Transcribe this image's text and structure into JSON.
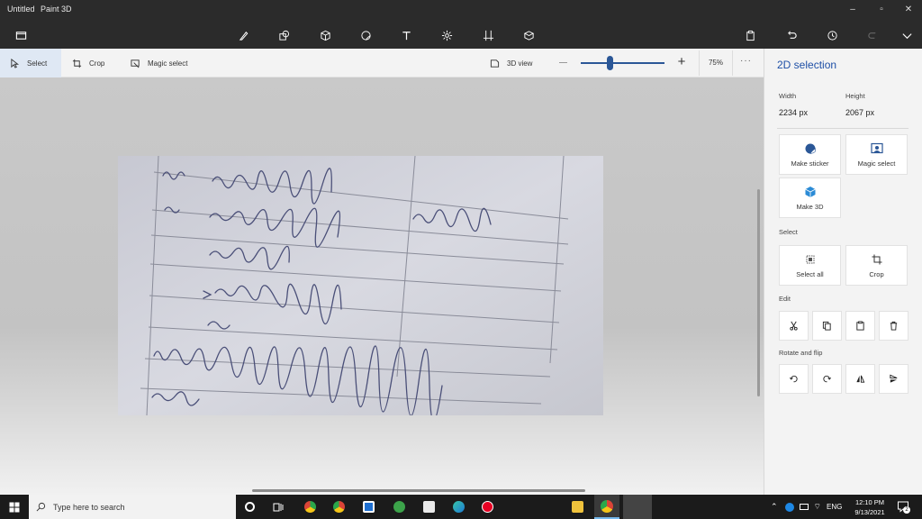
{
  "window": {
    "doc_name": "Untitled",
    "app_name": "Paint 3D"
  },
  "window_controls": {
    "minimize": "–",
    "restore": "▫",
    "close": "✕"
  },
  "main_tools": [
    "brushes-icon",
    "2d-shapes-icon",
    "3d-shapes-icon",
    "stickers-icon",
    "text-icon",
    "effects-icon",
    "canvas-icon",
    "3d-library-icon"
  ],
  "toolbar2": {
    "select": "Select",
    "crop": "Crop",
    "magic_select": "Magic select",
    "view_3d": "3D view",
    "zoom_plus": "+",
    "zoom_level": "75%",
    "zoom_fraction": 0.35,
    "more": "···"
  },
  "panel": {
    "title": "2D selection",
    "width_label": "Width",
    "width_value": "2234 px",
    "height_label": "Height",
    "height_value": "2067 px",
    "make_sticker": "Make sticker",
    "magic_select": "Magic select",
    "make_3d": "Make 3D",
    "select_section": "Select",
    "select_all": "Select all",
    "crop": "Crop",
    "edit_section": "Edit",
    "rotate_section": "Rotate and flip"
  },
  "taskbar": {
    "search_placeholder": "Type here to search",
    "lang": "ENG",
    "time": "12:10 PM",
    "date": "9/13/2021",
    "notifications": "2"
  },
  "colors": {
    "accent": "#2b5797",
    "title_accent": "#1e4fa6",
    "dark_bar": "#2b2b2b"
  }
}
